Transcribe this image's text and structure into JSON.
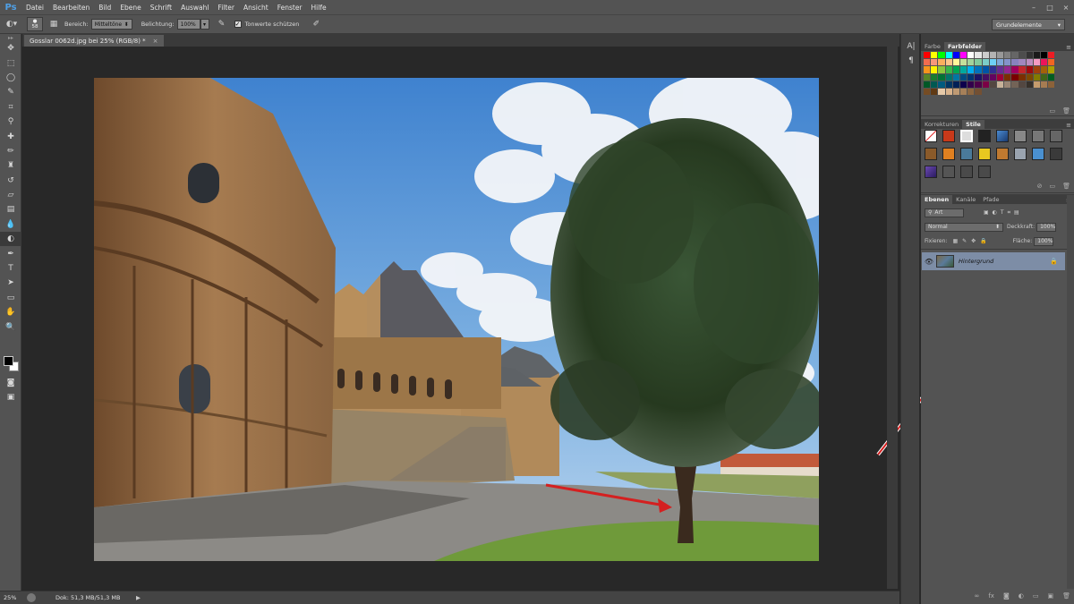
{
  "app": {
    "logo": "Ps"
  },
  "menu": [
    "Datei",
    "Bearbeiten",
    "Bild",
    "Ebene",
    "Schrift",
    "Auswahl",
    "Filter",
    "Ansicht",
    "Fenster",
    "Hilfe"
  ],
  "window_controls": {
    "minimize": "–",
    "maximize": "□",
    "close": "×"
  },
  "options": {
    "brush_size": "58",
    "bereich_label": "Bereich:",
    "bereich_value": "Mitteltöne",
    "belichtung_label": "Belichtung:",
    "belichtung_value": "100%",
    "protect_label": "Tonwerte schützen",
    "protect_checked": "✓",
    "workspace": "Grundelemente"
  },
  "document": {
    "tab_title": "Gosslar 0062d.jpg bei 25% (RGB/8) *",
    "close": "×"
  },
  "status": {
    "zoom": "25%",
    "doc_size": "Dok: 51,3 MB/51,3 MB",
    "arrow": "▶"
  },
  "panels": {
    "color_tabs": [
      "Farbe",
      "Farbfelder"
    ],
    "style_tabs": [
      "Korrekturen",
      "Stile"
    ],
    "layer_tabs": [
      "Ebenen",
      "Kanäle",
      "Pfade"
    ],
    "filter_kind": "Art",
    "blend_mode": "Normal",
    "opacity_label": "Deckkraft:",
    "opacity_value": "100%",
    "lock_label": "Fixieren:",
    "fill_label": "Fläche:",
    "fill_value": "100%",
    "layer_name": "Hintergrund"
  },
  "colors": {
    "annotation_arrow": "#d42020",
    "selected_layer": "#7d8da6"
  }
}
